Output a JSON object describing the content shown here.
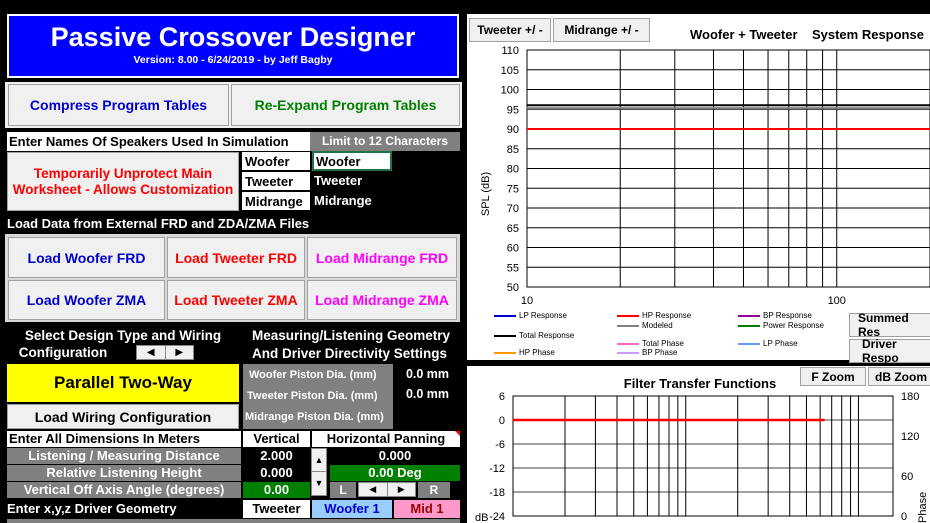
{
  "title": {
    "main": "Passive Crossover Designer",
    "sub": "Version: 8.00  -  6/24/2019 -  by Jeff Bagby"
  },
  "buttons": {
    "compress": "Compress Program Tables",
    "reexpand": "Re-Expand Program Tables",
    "unprotect": "Temporarily Unprotect Main Worksheet - Allows Customization",
    "load_woofer_frd": "Load Woofer FRD",
    "load_tweeter_frd": "Load Tweeter FRD",
    "load_midrange_frd": "Load Midrange FRD",
    "load_woofer_zma": "Load Woofer ZMA",
    "load_tweeter_zma": "Load Tweeter ZMA",
    "load_midrange_zma": "Load Midrange ZMA",
    "load_wiring": "Load Wiring Configuration",
    "tweeter_pm": "Tweeter +/ -",
    "midrange_pm": "Midrange  +/ -",
    "summed": "Summed Res",
    "driver_resp": "Driver Respo",
    "f_zoom": "F Zoom",
    "db_zoom": "dB Zoom"
  },
  "colors": {
    "title_bg": "#0000ff",
    "blue_text": "#0000cc",
    "green_text": "#008000",
    "red_text": "#ff0000",
    "magenta_text": "#ff00ff",
    "yellow": "#ffff00",
    "gray_cell": "#808080",
    "green_cell": "#008000",
    "pink_cell": "#ff99cc",
    "lightblue_cell": "#99ccff"
  },
  "speaker_names": {
    "header": "Enter Names Of Speakers Used In Simulation",
    "limit": "Limit to 12 Characters",
    "rows": [
      {
        "label": "Woofer",
        "value": "Woofer"
      },
      {
        "label": "Tweeter",
        "value": "Tweeter"
      },
      {
        "label": "Midrange",
        "value": "Midrange"
      }
    ]
  },
  "load_section": {
    "header": "Load Data from External FRD and ZDA/ZMA Files"
  },
  "design": {
    "select_label_1": "Select Design Type and Wiring",
    "select_label_2": "Configuration",
    "design_type": "Parallel Two-Way",
    "geometry_label_1": "Measuring/Listening Geometry",
    "geometry_label_2": "And Driver Directivity Settings",
    "woofer_piston": "Woofer Piston Dia. (mm)",
    "tweeter_piston": "Tweeter Piston Dia. (mm)",
    "midrange_piston": "Midrange Piston Dia. (mm)",
    "woofer_piston_val": "0.0 mm",
    "tweeter_piston_val": "0.0 mm"
  },
  "dimensions": {
    "header": "Enter All Dimensions In Meters",
    "vertical": "Vertical",
    "horizontal": "Horizontal Panning",
    "listening_distance_label": "Listening / Measuring  Distance",
    "listening_distance_val": "2.000",
    "listening_distance_h": "0.000",
    "relative_height_label": "Relative Listening Height",
    "relative_height_val": "0.000",
    "relative_height_h": "0.00 Deg",
    "vertical_angle_label": "Vertical Off Axis Angle (degrees)",
    "vertical_angle_val": "0.00",
    "pan_l": "L",
    "pan_r": "R",
    "xyz_label": "Enter x,y,z Driver Geometry",
    "col_tweeter": "Tweeter",
    "col_woofer": "Woofer 1",
    "col_mid": "Mid 1"
  },
  "chart_top": {
    "title": "Woofer + Tweeter    System Response",
    "ylabel": "SPL (dB)",
    "legend": [
      {
        "name": "LP Response",
        "color": "#0000cc"
      },
      {
        "name": "HP Response",
        "color": "#ff0000"
      },
      {
        "name": "BP Response",
        "color": "#990099"
      },
      {
        "name": "Modeled",
        "color": "#808080"
      },
      {
        "name": "Power Response",
        "color": "#008000"
      },
      {
        "name": "Total Response",
        "color": "#000000"
      },
      {
        "name": "Total Phase",
        "color": "#ff66cc"
      },
      {
        "name": "LP Phase",
        "color": "#6699ff"
      },
      {
        "name": "HP Phase",
        "color": "#ff9900"
      },
      {
        "name": "BP Phase",
        "color": "#cc99ff"
      }
    ]
  },
  "chart_bottom": {
    "title": "Filter Transfer Functions",
    "ylabel": "dB",
    "y2label": "Phase"
  },
  "chart_data": [
    {
      "type": "line",
      "title": "Woofer + Tweeter    System Response",
      "ylabel": "SPL (dB)",
      "xlabel": "",
      "xscale": "log",
      "xlim": [
        10,
        200
      ],
      "ylim": [
        50,
        110
      ],
      "yticks": [
        110,
        105,
        100,
        95,
        90,
        85,
        80,
        75,
        70,
        65,
        60,
        55,
        50
      ],
      "xticks": [
        10,
        100
      ],
      "grid": true,
      "series": [
        {
          "name": "HP Response",
          "color": "#ff0000",
          "x": [
            10,
            200
          ],
          "y": [
            90,
            90
          ]
        },
        {
          "name": "Total Response",
          "color": "#000000",
          "x": [
            10,
            200
          ],
          "y": [
            96,
            96
          ]
        },
        {
          "name": "Modeled",
          "color": "#808080",
          "x": [
            10,
            200
          ],
          "y": [
            95.3,
            95.3
          ]
        }
      ]
    },
    {
      "type": "line",
      "title": "Filter Transfer Functions",
      "ylabel": "dB",
      "y2label": "Phase",
      "xscale": "log",
      "ylim": [
        -24,
        6
      ],
      "yticks": [
        6,
        0,
        -6,
        -12,
        -18,
        -24
      ],
      "y2ticks": [
        180,
        120,
        60,
        0
      ],
      "grid": true,
      "series": [
        {
          "name": "HP Response",
          "color": "#ff0000",
          "y": [
            0,
            0
          ]
        }
      ]
    }
  ]
}
